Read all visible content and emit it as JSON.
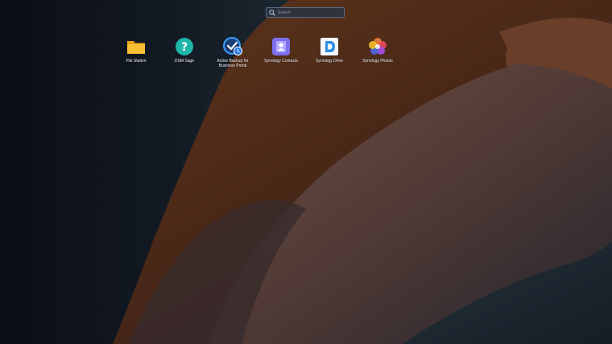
{
  "search": {
    "placeholder": "Search"
  },
  "apps": [
    {
      "label": "File Station",
      "icon": "folder-icon",
      "color": "#f5b623"
    },
    {
      "label": "DSM Sage",
      "icon": "help-question-icon",
      "color": "#1fb5a8"
    },
    {
      "label": "Active Backup for Business Portal",
      "icon": "backup-clock-icon",
      "color": "#2a7de1"
    },
    {
      "label": "Synology Contacts",
      "icon": "contacts-icon",
      "color": "#7c6ff0"
    },
    {
      "label": "Synology Drive",
      "icon": "drive-icon",
      "color": "#2f8ee8"
    },
    {
      "label": "Synology Photos",
      "icon": "photos-flower-icon",
      "color": "#f0813c"
    }
  ]
}
